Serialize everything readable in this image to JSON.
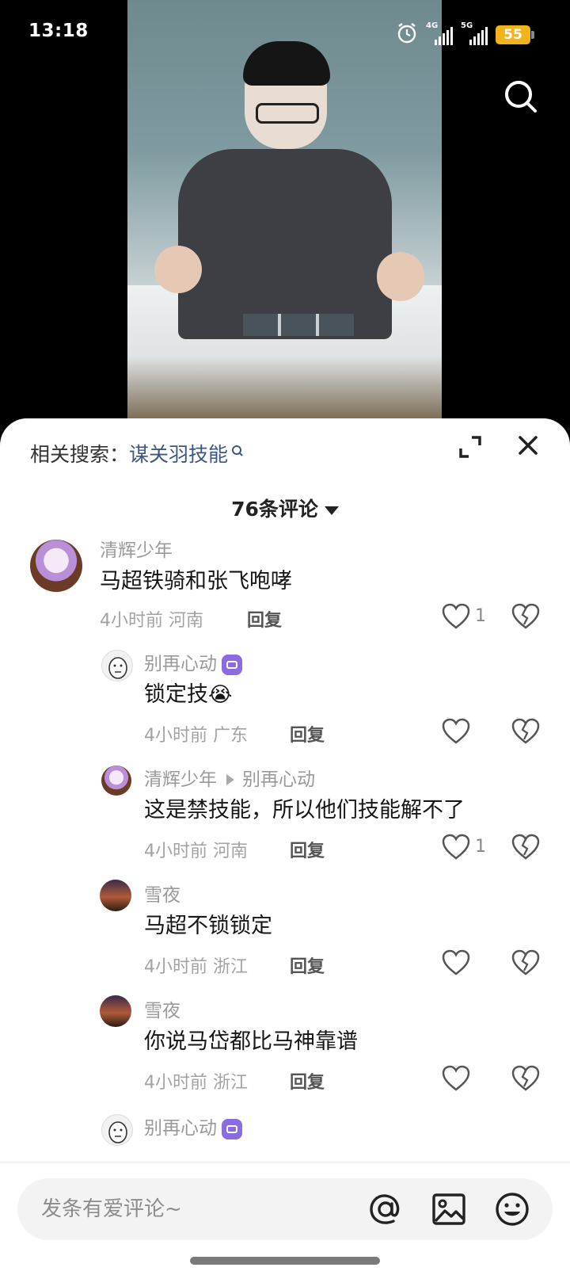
{
  "status_bar": {
    "time": "13:18",
    "network_1": "4G",
    "network_2": "5G",
    "battery": "55",
    "battery_color": "#f2b41b"
  },
  "video": {
    "search_icon": "search-icon"
  },
  "comments_panel": {
    "related_label": "相关搜索：",
    "related_keyword": "谋关羽技能",
    "expand_icon": "expand-icon",
    "close_icon": "close-icon",
    "count_label": "76条评论",
    "accent_color": "#3c5686"
  },
  "comments": [
    {
      "user": "清辉少年",
      "text": "马超铁骑和张飞咆哮",
      "time": "4小时前",
      "region": "河南",
      "reply": "回复",
      "likes": "1"
    },
    {
      "user": "别再心动",
      "text": "锁定技",
      "emoji": "😭",
      "time": "4小时前",
      "region": "广东",
      "reply": "回复",
      "likes": ""
    },
    {
      "user": "清辉少年",
      "reply_to": "别再心动",
      "text": "这是禁技能，所以他们技能解不了",
      "time": "4小时前",
      "region": "河南",
      "reply": "回复",
      "likes": "1"
    },
    {
      "user": "雪夜",
      "text": "马超不锁锁定",
      "time": "4小时前",
      "region": "浙江",
      "reply": "回复",
      "likes": ""
    },
    {
      "user": "雪夜",
      "text": "你说马岱都比马神靠谱",
      "time": "4小时前",
      "region": "浙江",
      "reply": "回复",
      "likes": ""
    },
    {
      "user": "别再心动"
    }
  ],
  "input_bar": {
    "placeholder": "发条有爱评论~",
    "at_icon": "at-icon",
    "image_icon": "image-icon",
    "emoji_icon": "emoji-icon"
  }
}
